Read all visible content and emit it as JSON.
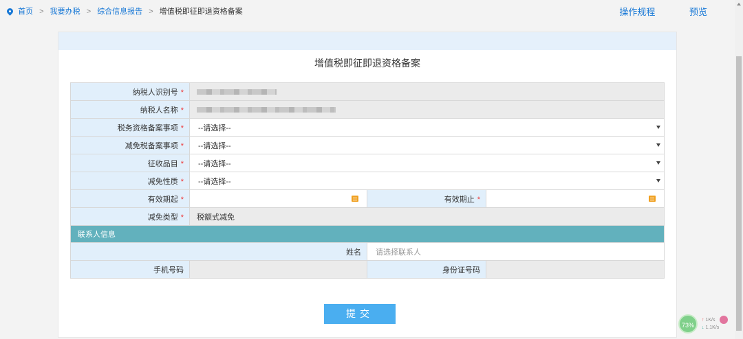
{
  "breadcrumb": {
    "home": "首页",
    "level1": "我要办税",
    "level2": "综合信息报告",
    "current": "增值税即征即退资格备案",
    "separator": ">"
  },
  "top_links": {
    "rules": "操作规程",
    "preview": "预览"
  },
  "form": {
    "title": "增值税即征即退资格备案",
    "required_mark": "*",
    "taxpayer_id_label": "纳税人识别号",
    "taxpayer_name_label": "纳税人名称",
    "qualification_label": "税务资格备案事项",
    "qualification_value": "--请选择--",
    "exemption_item_label": "减免税备案事项",
    "exemption_item_value": "--请选择--",
    "levy_item_label": "征收品目",
    "levy_item_value": "--请选择--",
    "exemption_nature_label": "减免性质",
    "exemption_nature_value": "--请选择--",
    "valid_from_label": "有效期起",
    "valid_to_label": "有效期止",
    "exemption_type_label": "减免类型",
    "exemption_type_value": "税额式减免"
  },
  "contact": {
    "section_title": "联系人信息",
    "name_label": "姓名",
    "name_placeholder": "请选择联系人",
    "phone_label": "手机号码",
    "id_label": "身份证号码"
  },
  "submit_label": "提交",
  "net_monitor": {
    "percent": "73%",
    "upload": "1K/s",
    "download": "1.1K/s"
  },
  "icons": {
    "location": "location-pin-icon",
    "dropdown": "chevron-down-icon",
    "calendar": "calendar-icon"
  }
}
